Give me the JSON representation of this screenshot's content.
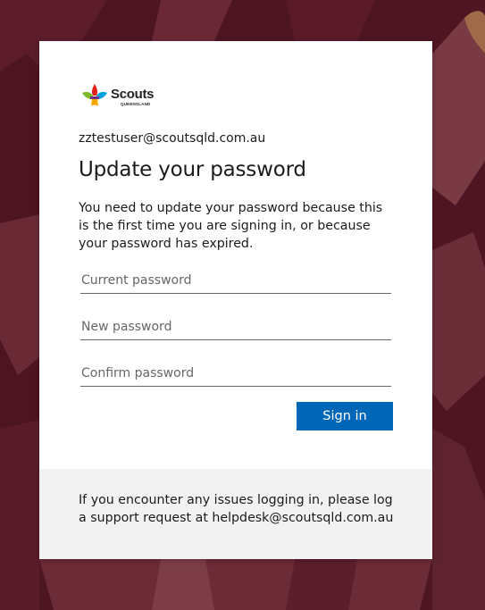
{
  "brand": {
    "name": "Scouts",
    "subtitle": "QUEENSLAND"
  },
  "account": {
    "email": "zztestuser@scoutsqld.com.au"
  },
  "form": {
    "title": "Update your password",
    "description": "You need to update your password because this is the first time you are signing in, or because your password has expired.",
    "current_password_placeholder": "Current password",
    "new_password_placeholder": "New password",
    "confirm_password_placeholder": "Confirm password",
    "submit_label": "Sign in"
  },
  "footer": {
    "text": "If you encounter any issues logging in, please log a support request at helpdesk@scoutsqld.com.au"
  },
  "colors": {
    "background": "#4a1320",
    "button": "#0067b8",
    "footer_bg": "#f2f2f2"
  }
}
